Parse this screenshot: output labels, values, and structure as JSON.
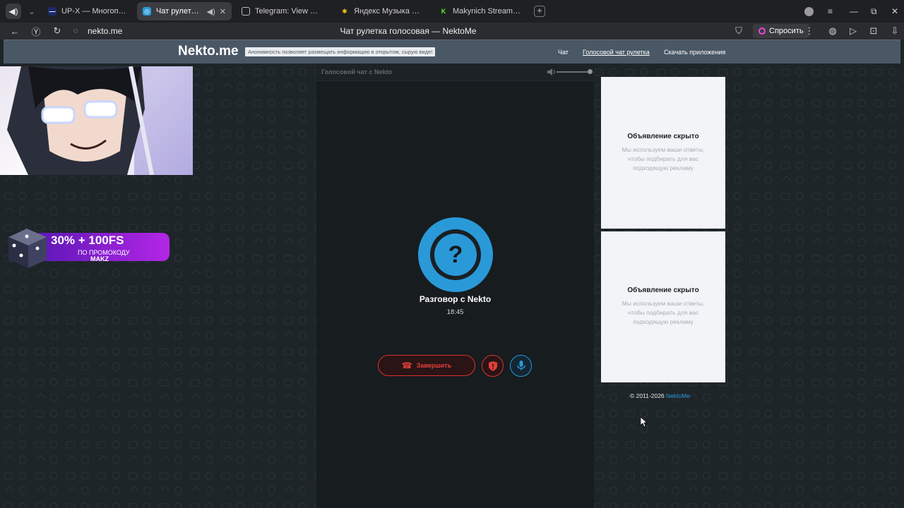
{
  "browser": {
    "tabs": [
      {
        "title": "UP-X — Многопользоват",
        "active": false,
        "icon": "upx-icon"
      },
      {
        "title": "Чат рулетка голосо",
        "active": true,
        "icon": "nekto-icon"
      },
      {
        "title": "Telegram: View @makynic",
        "active": false,
        "icon": "page-icon"
      },
      {
        "title": "Яндекс Музыка — собир",
        "active": false,
        "icon": "yandex-music-icon"
      },
      {
        "title": "Makynich Stream - Watch",
        "active": false,
        "icon": "kick-icon"
      }
    ],
    "url": "nekto.me",
    "page_title": "Чат рулетка голосовая — NektoMe",
    "ask_button": "Спросить"
  },
  "site": {
    "logo": "Nekto.me",
    "anon_notice": "Анонимность позволяет размещать информацию в открытом, сырую виде!",
    "nav": {
      "chat": "Чат",
      "voice_chat": "Голосовой чат рулетка",
      "download": "Скачать приложения"
    }
  },
  "promo": {
    "headline": "30% + 100FS",
    "subline": "ПО ПРОМОКОДУ",
    "code": "MAKZ"
  },
  "chat": {
    "header": "Голосовой чат с Nekto",
    "volume": 1.0,
    "avatar_symbol": "?",
    "partner": "Разговор с Nekto",
    "timer": "18:45",
    "end_button": "Завершить"
  },
  "ads": [
    {
      "title": "Объявление скрыто",
      "text": "Мы используем ваши ответы, чтобы подбирать для вас подходящую рекламу"
    },
    {
      "title": "Объявление скрыто",
      "text": "Мы используем ваши ответы, чтобы подбирать для вас подходящую рекламу"
    }
  ],
  "footer": {
    "copyright": "© 2011-2026",
    "link": "NektoMe"
  },
  "colors": {
    "accent": "#2a99d8",
    "danger": "#d9342e",
    "header_bg": "#4a5866",
    "page_bg": "#1e2529"
  }
}
